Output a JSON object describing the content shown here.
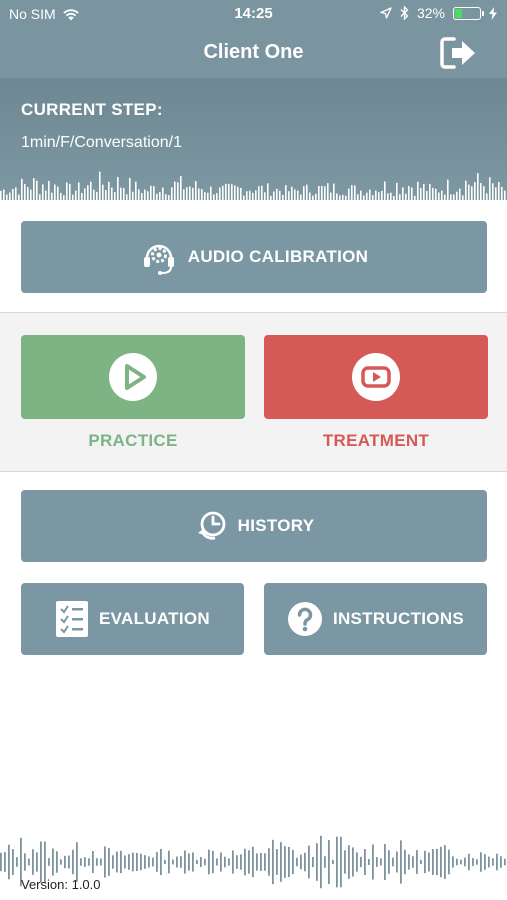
{
  "status": {
    "carrier": "No SIM",
    "time": "14:25",
    "battery": "32%",
    "battery_level": 0.32,
    "battery_color": "#4cd964"
  },
  "nav": {
    "title": "Client One",
    "logout_icon": "logout-icon"
  },
  "current_step": {
    "label": "CURRENT STEP:",
    "value": "1min/F/Conversation/1"
  },
  "buttons": {
    "audio_calibration": "AUDIO CALIBRATION",
    "practice": "PRACTICE",
    "treatment": "TREATMENT",
    "history": "HISTORY",
    "evaluation": "EVALUATION",
    "instructions": "INSTRUCTIONS"
  },
  "colors": {
    "primary": "#7a97a3",
    "practice": "#7eb384",
    "treatment": "#d55a57"
  },
  "footer": {
    "version": "Version: 1.0.0"
  }
}
